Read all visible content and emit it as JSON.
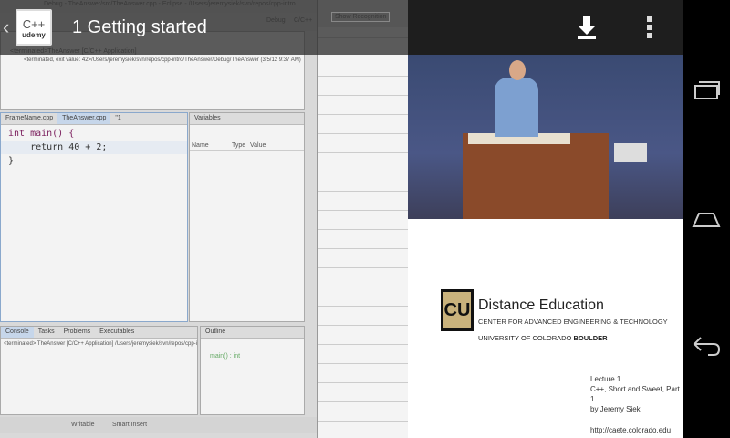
{
  "header": {
    "course": "C++",
    "brand": "udemy",
    "title": "1  Getting started"
  },
  "eclipse": {
    "window_title": "Debug - TheAnswer/src/TheAnswer.cpp - Eclipse - /Users/jeremysiek/svn/repos/cpp-intro",
    "perspectives": [
      "Debug",
      "C/C++"
    ],
    "show_recognition": "Show Recognition",
    "debug_tree": [
      "<terminated>TheAnswer [C/C++ Application]",
      "<terminated, exit value: 42>/Users/jeremysiek/svn/repos/cpp-intro/TheAnswer/Debug/TheAnswer (3/5/12 9:37 AM)"
    ],
    "editor_tabs": [
      "FrameName.cpp",
      "TheAnswer.cpp",
      "\"1"
    ],
    "code": [
      "int main() {",
      "    return 40 + 2;",
      "}"
    ],
    "variables_tab": "Variables",
    "variables_columns": [
      "Name",
      "Type",
      "Value"
    ],
    "console_tabs": [
      "Console",
      "Tasks",
      "Problems",
      "Executables"
    ],
    "console_line": "<terminated> TheAnswer [C/C++ Application] /Users/jeremysiek/svn/repos/cpp-intro/Th",
    "outline_tab": "Outline",
    "outline_item": "main() : int",
    "status": [
      "Writable",
      "Smart Insert"
    ]
  },
  "slide": {
    "heading": "Distance Education",
    "sub": "CENTER FOR ADVANCED ENGINEERING & TECHNOLOGY",
    "univ": "UNIVERSITY OF COLORADO ",
    "univ_bold": "BOULDER",
    "lecture": "Lecture 1",
    "topic": "C++, Short and Sweet, Part 1",
    "author": "by Jeremy Siek",
    "url": "http://caete.colorado.edu",
    "logo": "CU"
  }
}
